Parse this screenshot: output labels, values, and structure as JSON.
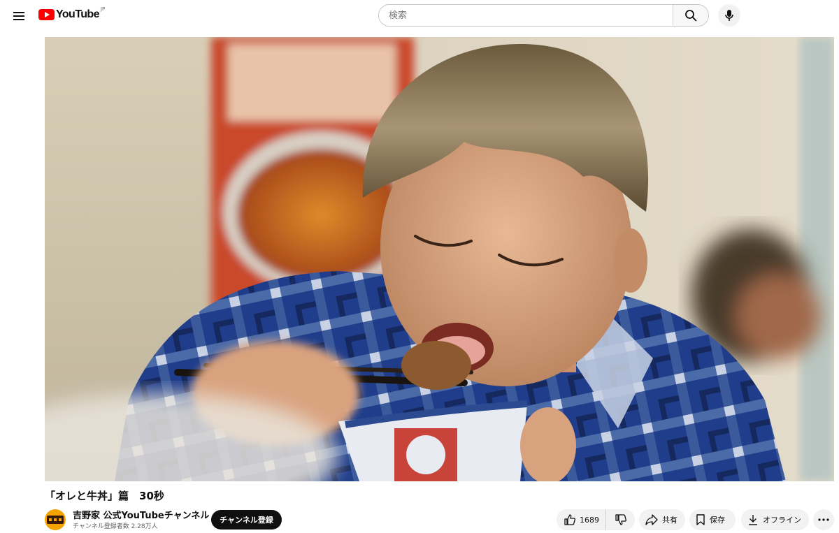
{
  "header": {
    "menu_icon": "hamburger-menu-icon",
    "logo_text": "YouTube",
    "logo_region": "JP",
    "search_placeholder": "検索",
    "search_icon": "search-icon",
    "mic_icon": "microphone-icon"
  },
  "video": {
    "title": "「オレと牛丼」篇　30秒",
    "channel": {
      "name": "吉野家 公式YouTubeチャンネル",
      "subscribers": "チャンネル登録者数 2.28万人",
      "avatar_icon": "yoshinoya-logo"
    },
    "subscribe_label": "チャンネル登録"
  },
  "actions": {
    "like_count": "1689",
    "like_icon": "thumbs-up-icon",
    "dislike_icon": "thumbs-down-icon",
    "share_label": "共有",
    "share_icon": "share-arrow-icon",
    "save_label": "保存",
    "save_icon": "bookmark-icon",
    "offline_label": "オフライン",
    "offline_icon": "download-icon",
    "more_icon": "more-horizontal-icon"
  },
  "colors": {
    "brand_red": "#ff0000",
    "subscribe_bg": "#0f0f0f",
    "pill_bg": "#f2f2f2"
  }
}
